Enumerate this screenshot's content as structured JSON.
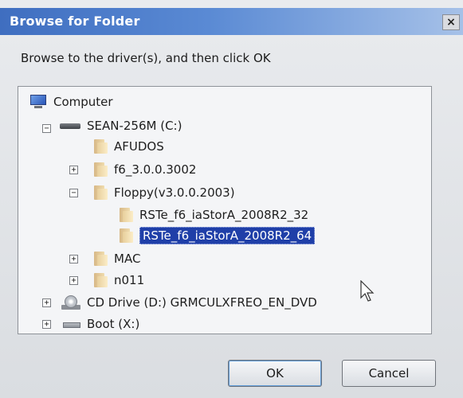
{
  "dialog": {
    "title": "Browse for Folder",
    "close_glyph": "×",
    "instruction": "Browse to the driver(s), and then click OK"
  },
  "tree": {
    "computer": "Computer",
    "drive_c": "SEAN-256M (C:)",
    "afudos": "AFUDOS",
    "f6": "f6_3.0.0.3002",
    "floppy": "Floppy(v3.0.0.2003)",
    "rste32": "RSTe_f6_iaStorA_2008R2_32",
    "rste64": "RSTe_f6_iaStorA_2008R2_64",
    "mac": "MAC",
    "n011": "n011",
    "cd_drive": "CD Drive (D:) GRMCULXFREO_EN_DVD",
    "boot": "Boot (X:)",
    "expand_glyph": "+",
    "collapse_glyph": "−"
  },
  "buttons": {
    "ok": "OK",
    "cancel": "Cancel"
  },
  "colors": {
    "title_bar": "#3f6ec0",
    "selection": "#1f3fa8"
  },
  "icons": [
    "computer-icon",
    "hard-drive-icon",
    "folder-icon",
    "cd-drive-icon",
    "removable-drive-icon",
    "mouse-cursor-icon"
  ]
}
